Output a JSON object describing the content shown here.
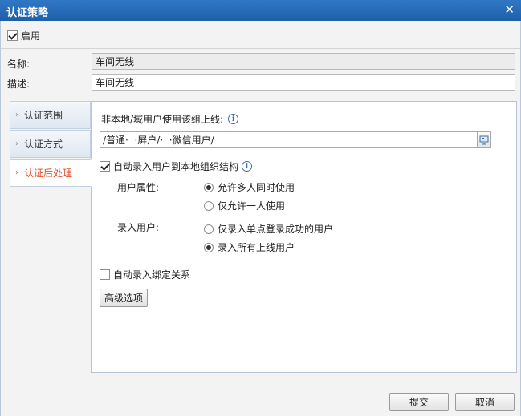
{
  "window": {
    "title": "认证策略",
    "close_glyph": "✕"
  },
  "enable": {
    "label": "启用",
    "checked": true
  },
  "fields": {
    "name_label": "名称:",
    "name_value": "车间无线",
    "desc_label": "描述:",
    "desc_value": "车间无线"
  },
  "tabs": [
    {
      "label": "认证范围",
      "active": false
    },
    {
      "label": "认证方式",
      "active": false
    },
    {
      "label": "认证后处理",
      "active": true
    }
  ],
  "panel": {
    "online_label": "非本地/域用户使用该组上线:",
    "path_value": "/普通·  ·屏户/·  ·微信用户/",
    "auto_record_label": "自动录入用户到本地组织结构",
    "auto_record_checked": true,
    "user_attr_label": "用户属性:",
    "user_attr_options": [
      {
        "label": "允许多人同时使用",
        "checked": true
      },
      {
        "label": "仅允许一人使用",
        "checked": false
      }
    ],
    "record_user_label": "录入用户:",
    "record_user_options": [
      {
        "label": "仅录入单点登录成功的用户",
        "checked": false
      },
      {
        "label": "录入所有上线用户",
        "checked": true
      }
    ],
    "auto_bind_label": "自动录入绑定关系",
    "auto_bind_checked": false,
    "advanced_button": "高级选项"
  },
  "footer": {
    "submit": "提交",
    "cancel": "取消"
  },
  "colors": {
    "titlebar": "#1f5fa8",
    "active_tab_text": "#e0502e",
    "info_icon": "#3a6fb0"
  },
  "icons": {
    "close": "close-icon",
    "tab_arrow": "chevron-right-icon",
    "info": "info-icon",
    "browse": "directory-browse-icon"
  }
}
